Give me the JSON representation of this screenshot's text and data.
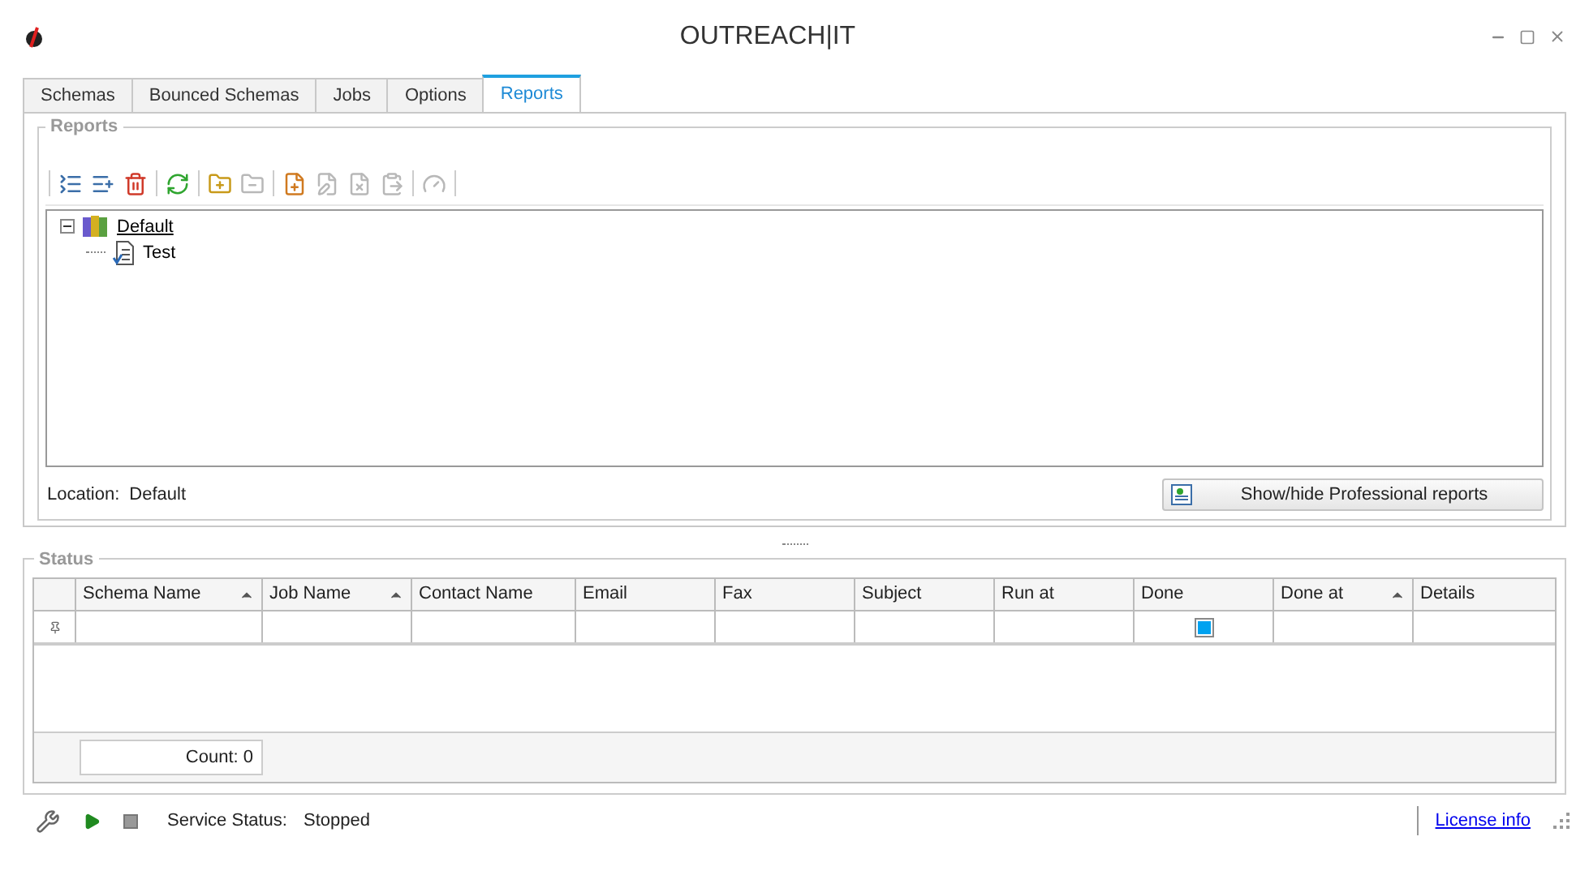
{
  "window": {
    "title": "OUTREACH|IT"
  },
  "tabs": [
    {
      "label": "Schemas",
      "selected": false
    },
    {
      "label": "Bounced Schemas",
      "selected": false
    },
    {
      "label": "Jobs",
      "selected": false
    },
    {
      "label": "Options",
      "selected": false
    },
    {
      "label": "Reports",
      "selected": true
    }
  ],
  "reports": {
    "title": "Reports",
    "toolbar": [
      {
        "kind": "collapse",
        "disabled": false
      },
      {
        "kind": "expand",
        "disabled": false
      },
      {
        "kind": "delete",
        "disabled": false
      },
      {
        "kind": "separator"
      },
      {
        "kind": "refresh",
        "disabled": false
      },
      {
        "kind": "separator"
      },
      {
        "kind": "add-folder",
        "disabled": false
      },
      {
        "kind": "remove-folder",
        "disabled": true
      },
      {
        "kind": "separator"
      },
      {
        "kind": "new-report",
        "disabled": false
      },
      {
        "kind": "edit",
        "disabled": true
      },
      {
        "kind": "delete-report",
        "disabled": true
      },
      {
        "kind": "paste",
        "disabled": true
      },
      {
        "kind": "separator"
      },
      {
        "kind": "gauge",
        "disabled": true
      },
      {
        "kind": "separator"
      }
    ],
    "tree": [
      {
        "label": "Default",
        "expanded": true,
        "children": [
          {
            "label": "Test"
          }
        ]
      }
    ],
    "location_label": "Location:",
    "location_value": "Default",
    "toggle_button": "Show/hide Professional reports"
  },
  "status": {
    "title": "Status",
    "columns": [
      {
        "label": "Schema Name",
        "sorted": true
      },
      {
        "label": "Job Name",
        "sorted": true
      },
      {
        "label": "Contact Name",
        "sorted": false
      },
      {
        "label": "Email",
        "sorted": false
      },
      {
        "label": "Fax",
        "sorted": false
      },
      {
        "label": "Subject",
        "sorted": false
      },
      {
        "label": "Run at",
        "sorted": false
      },
      {
        "label": "Done",
        "sorted": false
      },
      {
        "label": "Done at",
        "sorted": true
      },
      {
        "label": "Details",
        "sorted": false
      }
    ],
    "done_filter": {
      "indeterminate": true
    },
    "count": "Count: 0"
  },
  "status_bar": {
    "service_label": "Service Status:",
    "service_value": "Stopped",
    "license_link": "License info"
  }
}
